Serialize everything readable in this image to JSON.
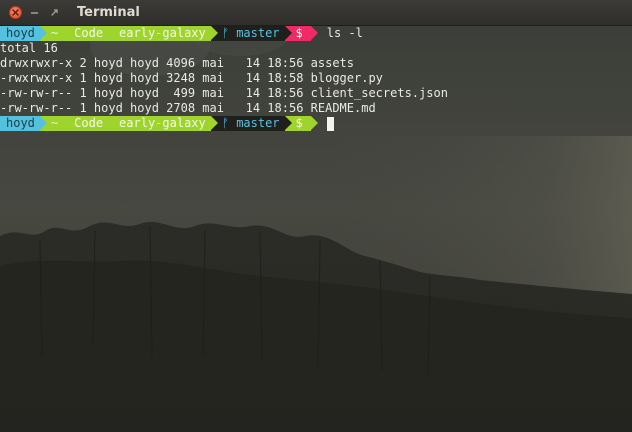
{
  "window": {
    "title": "Terminal"
  },
  "prompt": {
    "user": "hoyd",
    "home": "~",
    "dir1": "Code",
    "dir2": "early-galaxy",
    "branch_icon": "git-branch-icon",
    "branch": "master",
    "symbol": "$"
  },
  "command": "ls -l",
  "output": {
    "total": "total 16",
    "rows": [
      "drwxrwxr-x 2 hoyd hoyd 4096 mai   14 18:56 assets",
      "-rwxrwxr-x 1 hoyd hoyd 3248 mai   14 18:58 blogger.py",
      "-rw-rw-r-- 1 hoyd hoyd  499 mai   14 18:56 client_secrets.json",
      "-rw-rw-r-- 1 hoyd hoyd 2708 mai   14 18:56 README.md"
    ]
  },
  "colors": {
    "user_segment": "#54c1de",
    "path_segment": "#9fd42c",
    "git_segment": "#1f201c",
    "dollar_segment_error": "#ee2b65",
    "dollar_segment_ok": "#9fd42c",
    "close_button": "#e14a2a"
  }
}
